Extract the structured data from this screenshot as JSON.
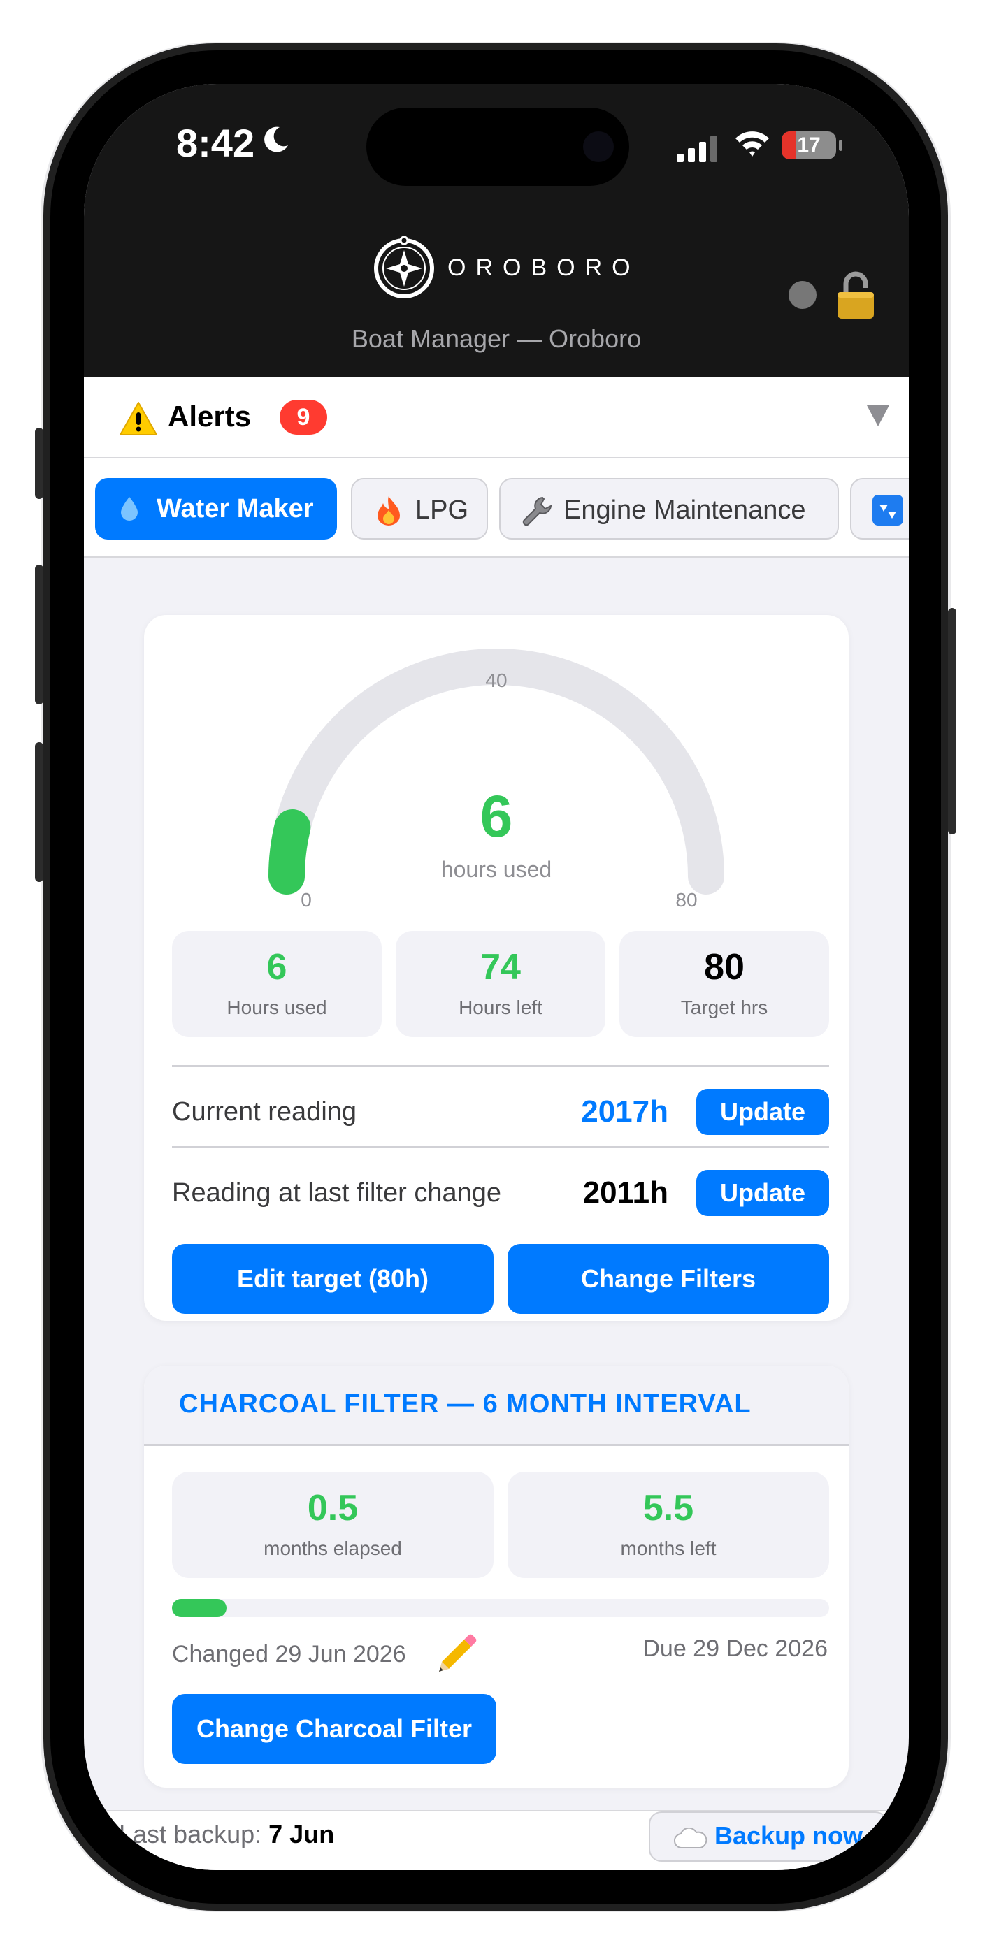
{
  "status_bar": {
    "time": "8:42",
    "battery": "17"
  },
  "header": {
    "brand": "OROBORO",
    "subtitle": "Boat Manager — Oroboro"
  },
  "alerts": {
    "label": "Alerts",
    "count": "9"
  },
  "tabs": [
    {
      "label": "Water Maker",
      "icon": "water-drop-icon",
      "active": true
    },
    {
      "label": "LPG",
      "icon": "fire-icon",
      "active": false
    },
    {
      "label": "Engine Maintenance",
      "icon": "wrench-icon",
      "active": false
    },
    {
      "label": "",
      "icon": "blue-tile-icon",
      "active": false
    }
  ],
  "gauge": {
    "value": "6",
    "unit_label": "hours used",
    "min": "0",
    "mid": "40",
    "max": "80",
    "fraction": 0.075,
    "fill_color": "#34c759",
    "track_color": "#e5e5ea"
  },
  "stats": [
    {
      "value": "6",
      "label": "Hours used",
      "color": "#34c759"
    },
    {
      "value": "74",
      "label": "Hours left",
      "color": "#34c759"
    },
    {
      "value": "80",
      "label": "Target hrs",
      "color": "#000000"
    }
  ],
  "readings": [
    {
      "label": "Current reading",
      "value": "2017h",
      "button": "Update",
      "color": "#007aff"
    },
    {
      "label": "Reading at last filter change",
      "value": "2011h",
      "button": "Update",
      "color": "#000000"
    }
  ],
  "actions": {
    "edit_target": "Edit target (80h)",
    "change_filters": "Change Filters"
  },
  "charcoal": {
    "title": "CHARCOAL FILTER — 6 MONTH INTERVAL",
    "elapsed_value": "0.5",
    "elapsed_label": "months elapsed",
    "left_value": "5.5",
    "left_label": "months left",
    "progress_fraction": 0.083,
    "changed": "Changed 29 Jun 2026",
    "due": "Due 29 Dec 2026",
    "button": "Change Charcoal Filter"
  },
  "footer": {
    "backup_label": "Last backup:",
    "backup_date": "7 Jun",
    "backup_button": "Backup now"
  },
  "colors": {
    "accent": "#007aff",
    "success": "#34c759",
    "danger": "#ff3b30",
    "header_bg": "#161616"
  }
}
